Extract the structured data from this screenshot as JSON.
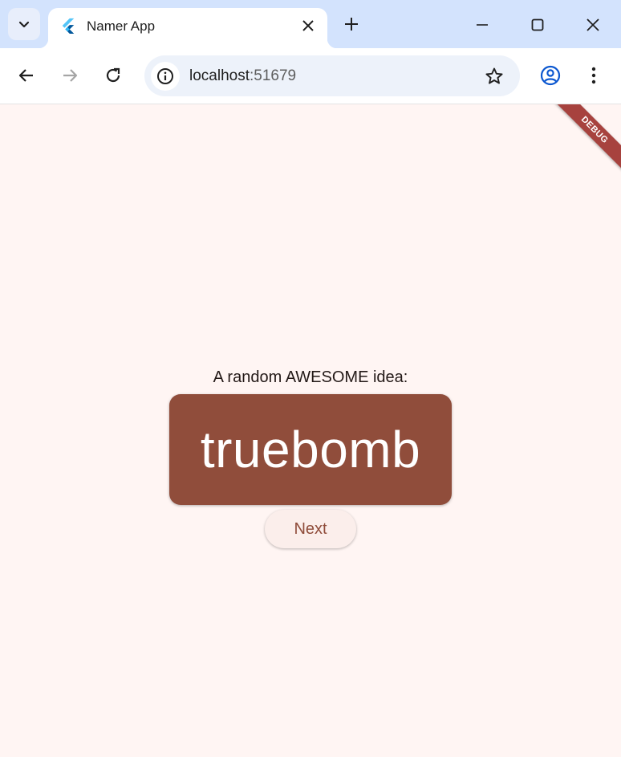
{
  "browser": {
    "tab": {
      "title": "Namer App"
    },
    "address_bar": {
      "host": "localhost",
      "port": ":51679"
    }
  },
  "debug_banner": {
    "label": "DEBUG"
  },
  "app": {
    "prompt": "A random AWESOME idea:",
    "word_pair": "truebomb",
    "next_button_label": "Next"
  },
  "colors": {
    "page_background": "#fff5f3",
    "card_background": "#904d3b",
    "button_text": "#8f4c3a",
    "debug_banner": "#a7423e"
  }
}
